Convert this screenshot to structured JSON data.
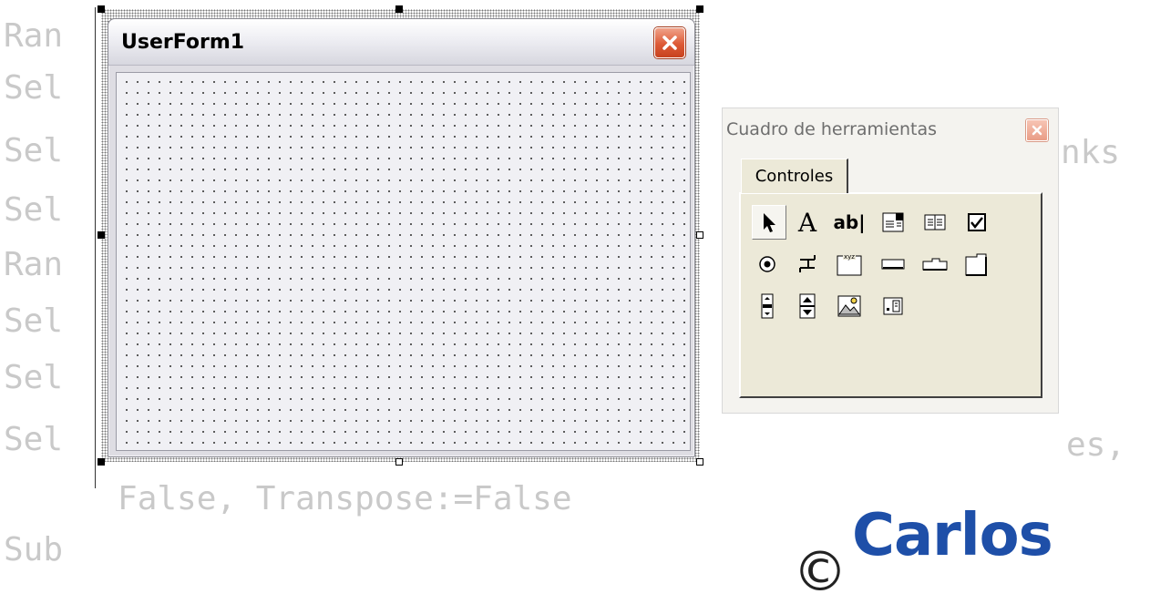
{
  "code_editor": {
    "lines": [
      "Ran",
      "Sel",
      "Sel",
      "Sel",
      "Ran",
      "Sel",
      "Sel",
      "Sel"
    ],
    "fragment_right_1": "nks",
    "fragment_right_2": "es,",
    "continuation_line": "   False, Transpose:=False",
    "end_line": "Sub"
  },
  "userform": {
    "title": "UserForm1"
  },
  "toolbox": {
    "title": "Cuadro de herramientas",
    "tab_label": "Controles",
    "tools": [
      {
        "name": "select-objects-icon"
      },
      {
        "name": "label-tool-icon",
        "glyph": "A"
      },
      {
        "name": "textbox-tool-icon",
        "glyph": "ab|"
      },
      {
        "name": "combobox-tool-icon"
      },
      {
        "name": "listbox-tool-icon"
      },
      {
        "name": "checkbox-tool-icon"
      },
      {
        "name": "optionbutton-tool-icon"
      },
      {
        "name": "togglebutton-tool-icon"
      },
      {
        "name": "frame-tool-icon"
      },
      {
        "name": "commandbutton-tool-icon"
      },
      {
        "name": "tabstrip-tool-icon"
      },
      {
        "name": "multipage-tool-icon"
      },
      {
        "name": "scrollbar-tool-icon"
      },
      {
        "name": "spinbutton-tool-icon"
      },
      {
        "name": "image-tool-icon"
      },
      {
        "name": "refedit-tool-icon"
      }
    ]
  },
  "logo": {
    "text": "Carlos",
    "symbol": "©"
  },
  "colors": {
    "logo_blue": "#1e4fa8",
    "close_red": "#dd5a36",
    "faded_code": "#c9c9c9"
  }
}
